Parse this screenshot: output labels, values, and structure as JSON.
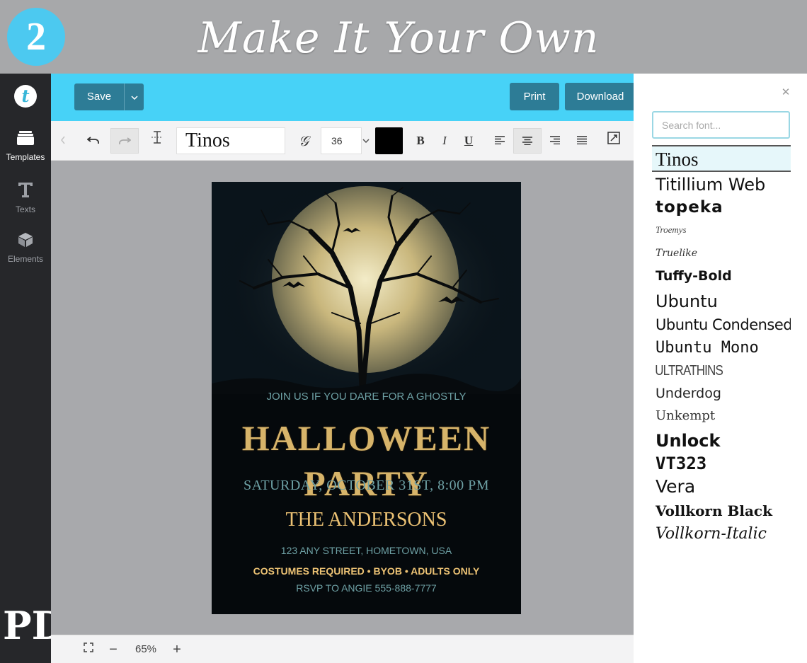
{
  "banner": {
    "step": "2",
    "title": "Make It Your Own"
  },
  "sidebar": {
    "logo": "t",
    "items": [
      {
        "label": "Templates"
      },
      {
        "label": "Texts"
      },
      {
        "label": "Elements"
      }
    ],
    "brand_mark": "PD"
  },
  "toolbar": {
    "save_label": "Save",
    "print_label": "Print",
    "download_label": "Download"
  },
  "format": {
    "font": "Tinos",
    "size": "36",
    "color": "#000000"
  },
  "invitation": {
    "line1": "JOIN US IF YOU DARE FOR A GHOSTLY",
    "headline": "HALLOWEEN PARTY",
    "date": "SATURDAY, OCTOBER 31ST, 8:00 PM",
    "host": "THE ANDERSONS",
    "address": "123 ANY STREET, HOMETOWN, USA",
    "notes": "COSTUMES REQUIRED • BYOB • ADULTS ONLY",
    "rsvp": "RSVP TO ANGIE 555-888-7777"
  },
  "zoom": {
    "level": "65%"
  },
  "font_panel": {
    "search_placeholder": "Search font...",
    "fonts": [
      "Tinos",
      "Titillium Web",
      "topeka",
      "Troemys",
      "Truelike",
      "Tuffy-Bold",
      "Ubuntu",
      "Ubuntu Condensed",
      "Ubuntu Mono",
      "ULTRATHINS",
      "Underdog",
      "Unkempt",
      "Unlock",
      "VT323",
      "Vera",
      "Vollkorn Black",
      "Vollkorn-Italic"
    ],
    "selected": "Tinos"
  },
  "colors": {
    "accent_cyan": "#47d2f7",
    "button_dark": "#2d7c96",
    "sidebar": "#26272a",
    "gold": "#d7b46a",
    "teal_text": "#6ea1a5"
  }
}
